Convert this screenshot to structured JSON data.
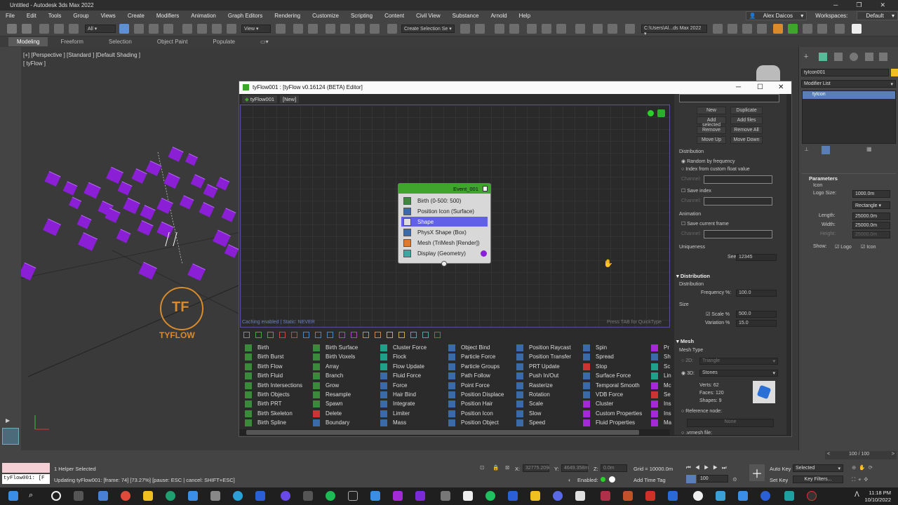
{
  "window": {
    "title": "Untitled - Autodesk 3ds Max 2022"
  },
  "menu": {
    "items": [
      "File",
      "Edit",
      "Tools",
      "Group",
      "Views",
      "Create",
      "Modifiers",
      "Animation",
      "Graph Editors",
      "Rendering",
      "Customize",
      "Scripting",
      "Content",
      "Civil View",
      "Substance",
      "Arnold",
      "Help"
    ],
    "user": "Alex Daicos",
    "workspace_label": "Workspaces:",
    "workspace_value": "Default"
  },
  "toolbar": {
    "filter": "All",
    "view": "View",
    "selection_set": "Create Selection Se",
    "path": "C:\\Users\\Al...ds Max 2022"
  },
  "ribbon": {
    "tabs": [
      "Modeling",
      "Freeform",
      "Selection",
      "Object Paint",
      "Populate"
    ],
    "active": "Modeling"
  },
  "viewport": {
    "label": "[+] [Perspective ] [Standard ] [Default Shading ]",
    "sublabel": "[ tyFlow ]",
    "logo_text": "TYFLOW"
  },
  "editor": {
    "title": "tyFlow001 : [tyFlow v0.16124 (BETA) Editor]",
    "tab_main": "tyFlow001",
    "tab_new": "[New]",
    "footer_left": "Caching enabled | Static: NEVER",
    "footer_right": "Press TAB for QuickType",
    "event": {
      "name": "Event_001",
      "operators": [
        "Birth (0-500: 500)",
        "Position Icon (Surface)",
        "Shape",
        "PhysX Shape (Box)",
        "Mesh (TriMesh [Render])",
        "Display (Geometry)"
      ],
      "selected": "Shape"
    },
    "operator_columns": [
      [
        "Birth",
        "Birth Burst",
        "Birth Flow",
        "Birth Fluid",
        "Birth Intersections",
        "Birth Objects",
        "Birth PRT",
        "Birth Skeleton",
        "Birth Spline"
      ],
      [
        "Birth Surface",
        "Birth Voxels",
        "Array",
        "Branch",
        "Grow",
        "Resample",
        "Spawn",
        "Delete",
        "Boundary"
      ],
      [
        "Cluster Force",
        "Flock",
        "Flow Update",
        "Fluid Force",
        "Force",
        "Hair Bind",
        "Integrate",
        "Limiter",
        "Mass"
      ],
      [
        "Object Bind",
        "Particle Force",
        "Particle Groups",
        "Path Follow",
        "Point Force",
        "Position Displace",
        "Position Hair",
        "Position Icon",
        "Position Object"
      ],
      [
        "Position Raycast",
        "Position Transfer",
        "PRT Update",
        "Push In/Out",
        "Rasterize",
        "Rotation",
        "Scale",
        "Slow",
        "Speed"
      ],
      [
        "Spin",
        "Spread",
        "Stop",
        "Surface Force",
        "Temporal Smooth",
        "VDB Force",
        "Cluster",
        "Custom Properties",
        "Fluid Properties"
      ],
      [
        "Pr",
        "Sh",
        "Sc",
        "Lin",
        "Mc",
        "Se",
        "Ins",
        "Ins",
        "Ma"
      ]
    ],
    "right_panel": {
      "buttons": [
        "New",
        "Duplicate",
        "Add selected",
        "Add files",
        "Remove",
        "Remove All",
        "Move Up",
        "Move Down"
      ],
      "distribution_head": "Distribution",
      "random_freq": "Random by frequency",
      "index_custom": "Index from custom float value",
      "channel": "Channel:",
      "save_index": "Save index",
      "animation_head": "Animation",
      "save_frame": "Save current frame",
      "uniqueness_head": "Uniqueness",
      "seed_label": "Seed:",
      "seed_value": "12345",
      "distribution_rollout": "Distribution",
      "distribution_sub": "Distribution",
      "frequency_label": "Frequency %:",
      "frequency_value": "100.0",
      "size_head": "Size",
      "scale_label": "Scale %",
      "scale_value": "500.0",
      "variation_label": "Variation %",
      "variation_value": "15.0",
      "mesh_rollout": "Mesh",
      "mesh_type": "Mesh Type",
      "two_d": "2D:",
      "two_d_value": "Triangle",
      "three_d": "3D:",
      "three_d_value": "Stones",
      "verts": "Verts: 62",
      "faces": "Faces: 120",
      "shapes": "Shapes: 9",
      "reference_node": "Reference node:",
      "none": "None",
      "vrmesh": ".vrmesh file:"
    }
  },
  "command_panel": {
    "object_name": "tyIcon001",
    "modifier_list": "Modifier List",
    "stack_item": "tyIcon",
    "parameters": "Parameters",
    "icon_label": "Icon",
    "logo_size_label": "Logo Size:",
    "logo_size": "1000.0m",
    "shape_value": "Rectangle",
    "length_label": "Length:",
    "length": "25000.0m",
    "width_label": "Width:",
    "width": "25000.0m",
    "height_label": "Height:",
    "height": "25000.0m",
    "show_label": "Show:",
    "show_logo": "Logo",
    "show_icon": "Icon"
  },
  "status": {
    "helper": "1 Helper Selected",
    "script_line": "tyFlow001: [F",
    "progress": "Updating tyFlow001: [frame: 74] [73.27%] [pause: ESC | cancel: SHIFT+ESC]",
    "x_label": "X:",
    "x_value": "32775.209i",
    "y_label": "Y:",
    "y_value": "4649.358m",
    "z_label": "Z:",
    "z_value": "0.0m",
    "grid": "Grid = 10000.0m",
    "enabled": "Enabled:",
    "add_time_tag": "Add Time Tag",
    "frame_counter": "100 / 100",
    "frame_value": "100",
    "auto_key": "Auto Key",
    "selected": "Selected",
    "set_key": "Set Key",
    "key_filters": "Key Filters..."
  },
  "taskbar": {
    "time": "11:18 PM",
    "date": "10/10/2022"
  },
  "colors": {
    "particle": "#8a1fd6",
    "event_head": "#3fa52c",
    "selected_op": "#6060e8",
    "logo": "#d98b2b"
  }
}
